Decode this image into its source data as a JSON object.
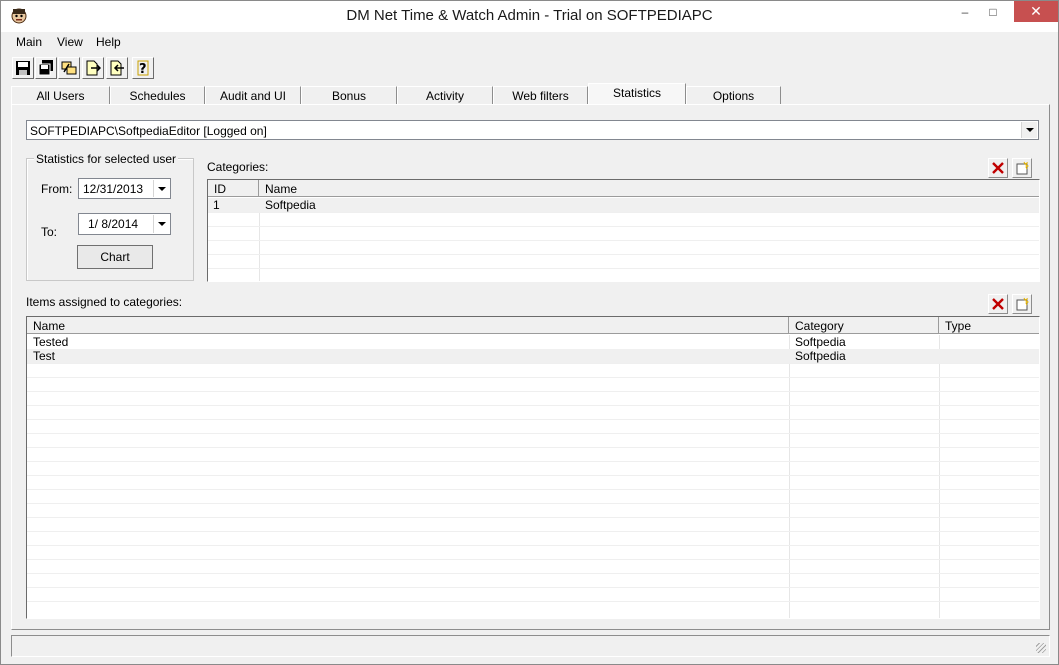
{
  "window": {
    "title": "DM Net Time & Watch Admin - Trial on SOFTPEDIAPC",
    "minimize": "–",
    "maximize": "□",
    "close": "✕"
  },
  "menu": [
    "Main",
    "View",
    "Help"
  ],
  "toolbar": {
    "buttons": [
      "save-icon",
      "save-all-icon",
      "connect-icon",
      "import-icon",
      "export-icon",
      "help-icon"
    ]
  },
  "tabs": [
    "All Users",
    "Schedules",
    "Audit and UI",
    "Bonus",
    "Activity",
    "Web filters",
    "Statistics",
    "Options"
  ],
  "active_tab": "Statistics",
  "user_select": {
    "value": "SOFTPEDIAPC\\SoftpediaEditor  [Logged on]"
  },
  "stats_group": {
    "legend": "Statistics for selected user",
    "from_label": "From:",
    "from_value": "12/31/2013",
    "to_label": "To:",
    "to_value": "1/  8/2014",
    "chart_button": "Chart"
  },
  "categories": {
    "label": "Categories:",
    "columns": [
      "ID",
      "Name"
    ],
    "rows": [
      {
        "id": "1",
        "name": "Softpedia"
      }
    ]
  },
  "items": {
    "label": "Items assigned to categories:",
    "columns": [
      "Name",
      "Category",
      "Type"
    ],
    "rows": [
      {
        "name": "Tested",
        "category": "Softpedia",
        "type": ""
      },
      {
        "name": "Test",
        "category": "Softpedia",
        "type": ""
      }
    ]
  },
  "colors": {
    "close_button": "#c75050",
    "delete_icon": "#c00000",
    "window_bg": "#f0f0f0"
  }
}
